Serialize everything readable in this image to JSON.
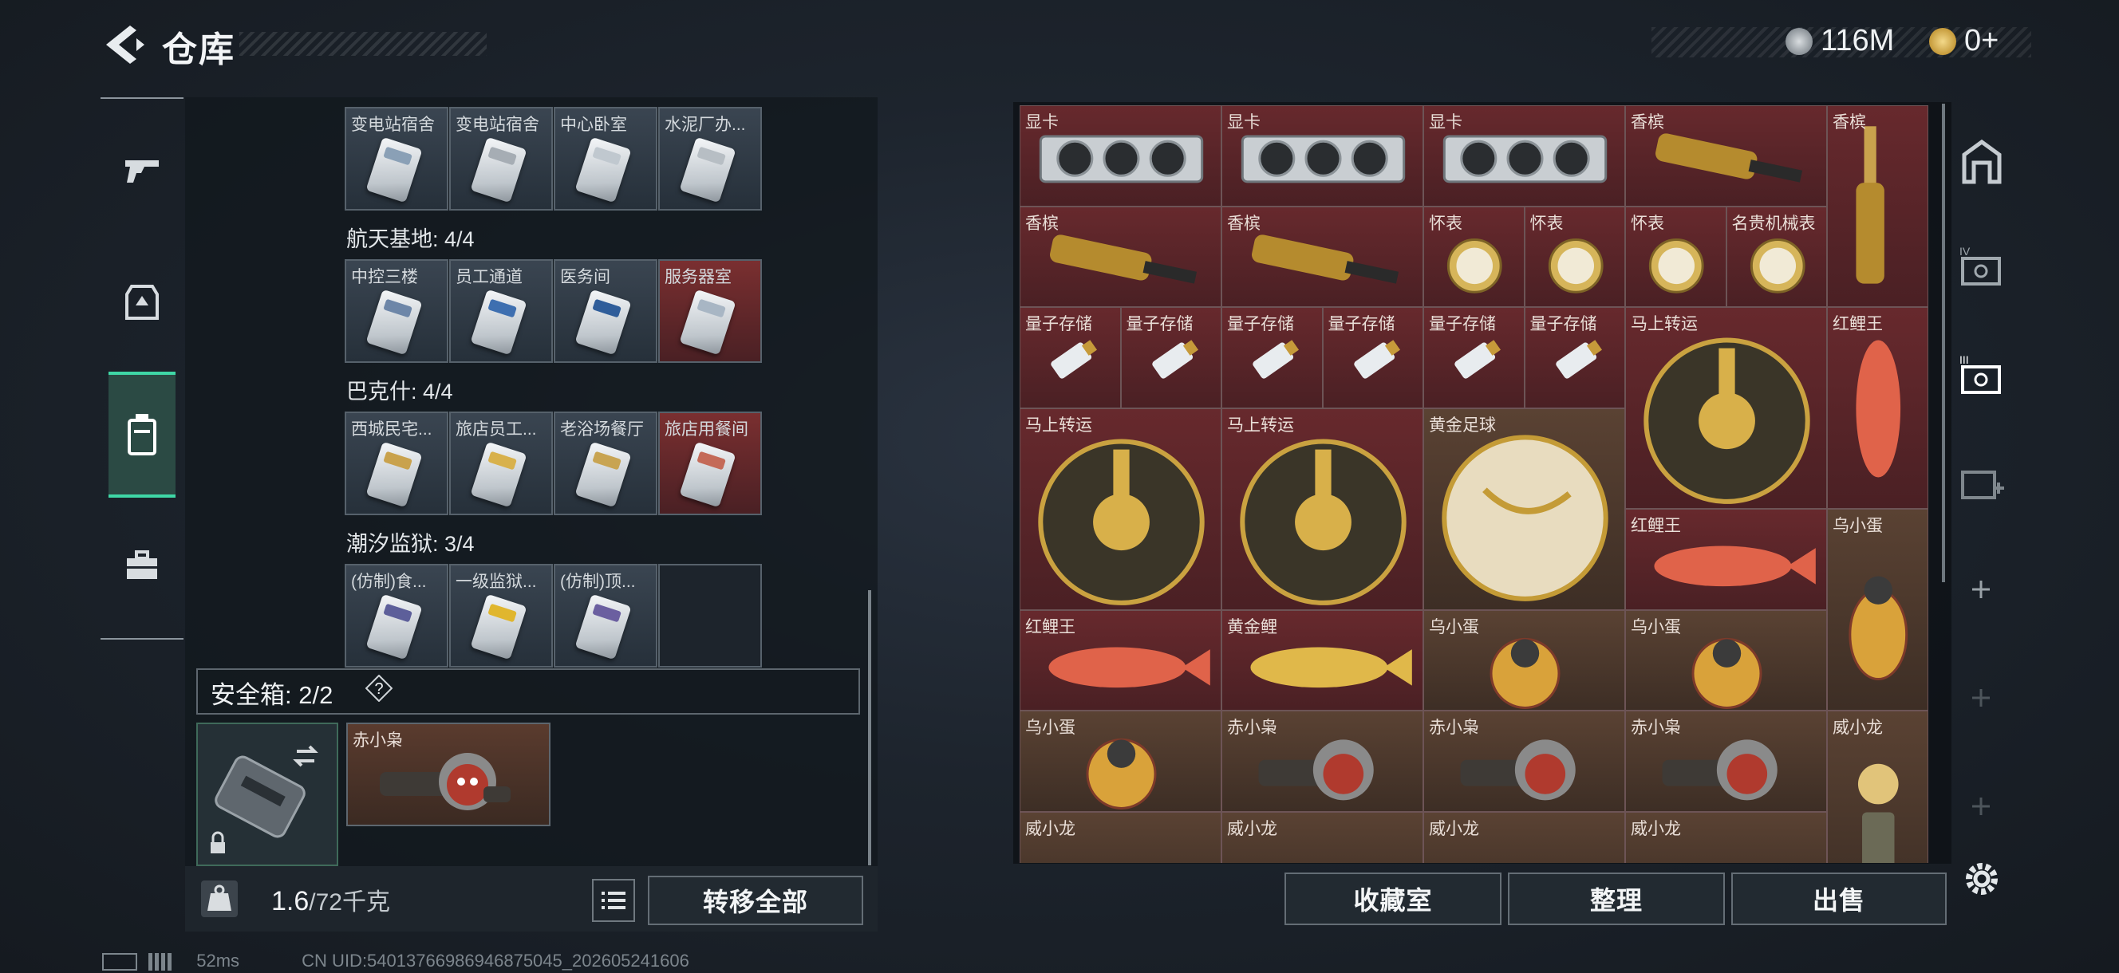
{
  "header": {
    "title": "仓库",
    "money_value": "116M",
    "tickets_value": "0+"
  },
  "left_panel": {
    "rows": [
      {
        "cards": [
          {
            "label": "变电站宿舍",
            "style": "normal",
            "kc": "#8aa0b6"
          },
          {
            "label": "变电站宿舍",
            "style": "normal",
            "kc": "#a6adb4"
          },
          {
            "label": "中心卧室",
            "style": "normal",
            "kc": "#c0c8cf"
          },
          {
            "label": "水泥厂办...",
            "style": "normal",
            "kc": "#b7bec4"
          }
        ]
      },
      {
        "section": "航天基地: 4/4",
        "cards": [
          {
            "label": "中控三楼",
            "style": "normal",
            "kc": "#6d86a8"
          },
          {
            "label": "员工通道",
            "style": "normal",
            "kc": "#3e6fb0"
          },
          {
            "label": "医务间",
            "style": "normal",
            "kc": "#2f5d9a"
          },
          {
            "label": "服务器室",
            "style": "red",
            "kc": "#a8b6c4"
          }
        ]
      },
      {
        "section": "巴克什: 4/4",
        "cards": [
          {
            "label": "西城民宅...",
            "style": "normal",
            "kc": "#c9a24d"
          },
          {
            "label": "旅店员工...",
            "style": "normal",
            "kc": "#d8b14c"
          },
          {
            "label": "老浴场餐厅",
            "style": "normal",
            "kc": "#c8a452"
          },
          {
            "label": "旅店用餐间",
            "style": "red",
            "kc": "#c46a58"
          }
        ]
      },
      {
        "section": "潮汐监狱: 3/4",
        "cards": [
          {
            "label": "(仿制)食...",
            "style": "normal",
            "kc": "#5d5f9a"
          },
          {
            "label": "一级监狱...",
            "style": "normal",
            "kc": "#e0b62e"
          },
          {
            "label": "(仿制)顶...",
            "style": "normal",
            "kc": "#6b5fa0"
          },
          {
            "label": "",
            "style": "empty",
            "kc": "#000"
          }
        ]
      }
    ],
    "safebox_label": "安全箱: 2/2",
    "safebox_help": "?",
    "safebox_item": "赤小枭",
    "weight_current": "1.6",
    "weight_max": "/72千克",
    "transfer_all": "转移全部"
  },
  "grid_items": [
    {
      "name": "显卡",
      "bg": "red"
    },
    {
      "name": "显卡",
      "bg": "red"
    },
    {
      "name": "显卡",
      "bg": "red"
    },
    {
      "name": "香槟",
      "bg": "red"
    },
    {
      "name": "香槟",
      "bg": "red"
    },
    {
      "name": "香槟",
      "bg": "red"
    },
    {
      "name": "香槟",
      "bg": "red"
    },
    {
      "name": "怀表",
      "bg": "red"
    },
    {
      "name": "怀表",
      "bg": "red"
    },
    {
      "name": "怀表",
      "bg": "red"
    },
    {
      "name": "名贵机械表",
      "bg": "red"
    },
    {
      "name": "量子存储",
      "bg": "red"
    },
    {
      "name": "量子存储",
      "bg": "red"
    },
    {
      "name": "量子存储",
      "bg": "red"
    },
    {
      "name": "量子存储",
      "bg": "red"
    },
    {
      "name": "量子存储",
      "bg": "red"
    },
    {
      "name": "量子存储",
      "bg": "red"
    },
    {
      "name": "马上转运",
      "bg": "red"
    },
    {
      "name": "红鲤王",
      "bg": "red"
    },
    {
      "name": "马上转运",
      "bg": "red"
    },
    {
      "name": "马上转运",
      "bg": "red"
    },
    {
      "name": "黄金足球",
      "bg": "brown"
    },
    {
      "name": "红鲤王",
      "bg": "red"
    },
    {
      "name": "乌小蛋",
      "bg": "brown"
    },
    {
      "name": "红鲤王",
      "bg": "red"
    },
    {
      "name": "黄金鲤",
      "bg": "red"
    },
    {
      "name": "乌小蛋",
      "bg": "brown"
    },
    {
      "name": "乌小蛋",
      "bg": "brown"
    },
    {
      "name": "乌小蛋",
      "bg": "brown"
    },
    {
      "name": "赤小枭",
      "bg": "brown"
    },
    {
      "name": "赤小枭",
      "bg": "brown"
    },
    {
      "name": "赤小枭",
      "bg": "brown"
    },
    {
      "name": "威小龙",
      "bg": "brown"
    },
    {
      "name": "威小龙",
      "bg": "brown"
    },
    {
      "name": "威小龙",
      "bg": "brown"
    },
    {
      "name": "威小龙",
      "bg": "brown"
    },
    {
      "name": "威小龙",
      "bg": "brown"
    }
  ],
  "buttons": {
    "collection": "收藏室",
    "organize": "整理",
    "sell": "出售"
  },
  "status": {
    "ping": "52ms",
    "uid": "CN UID:54013766986946875045_202605241606"
  }
}
